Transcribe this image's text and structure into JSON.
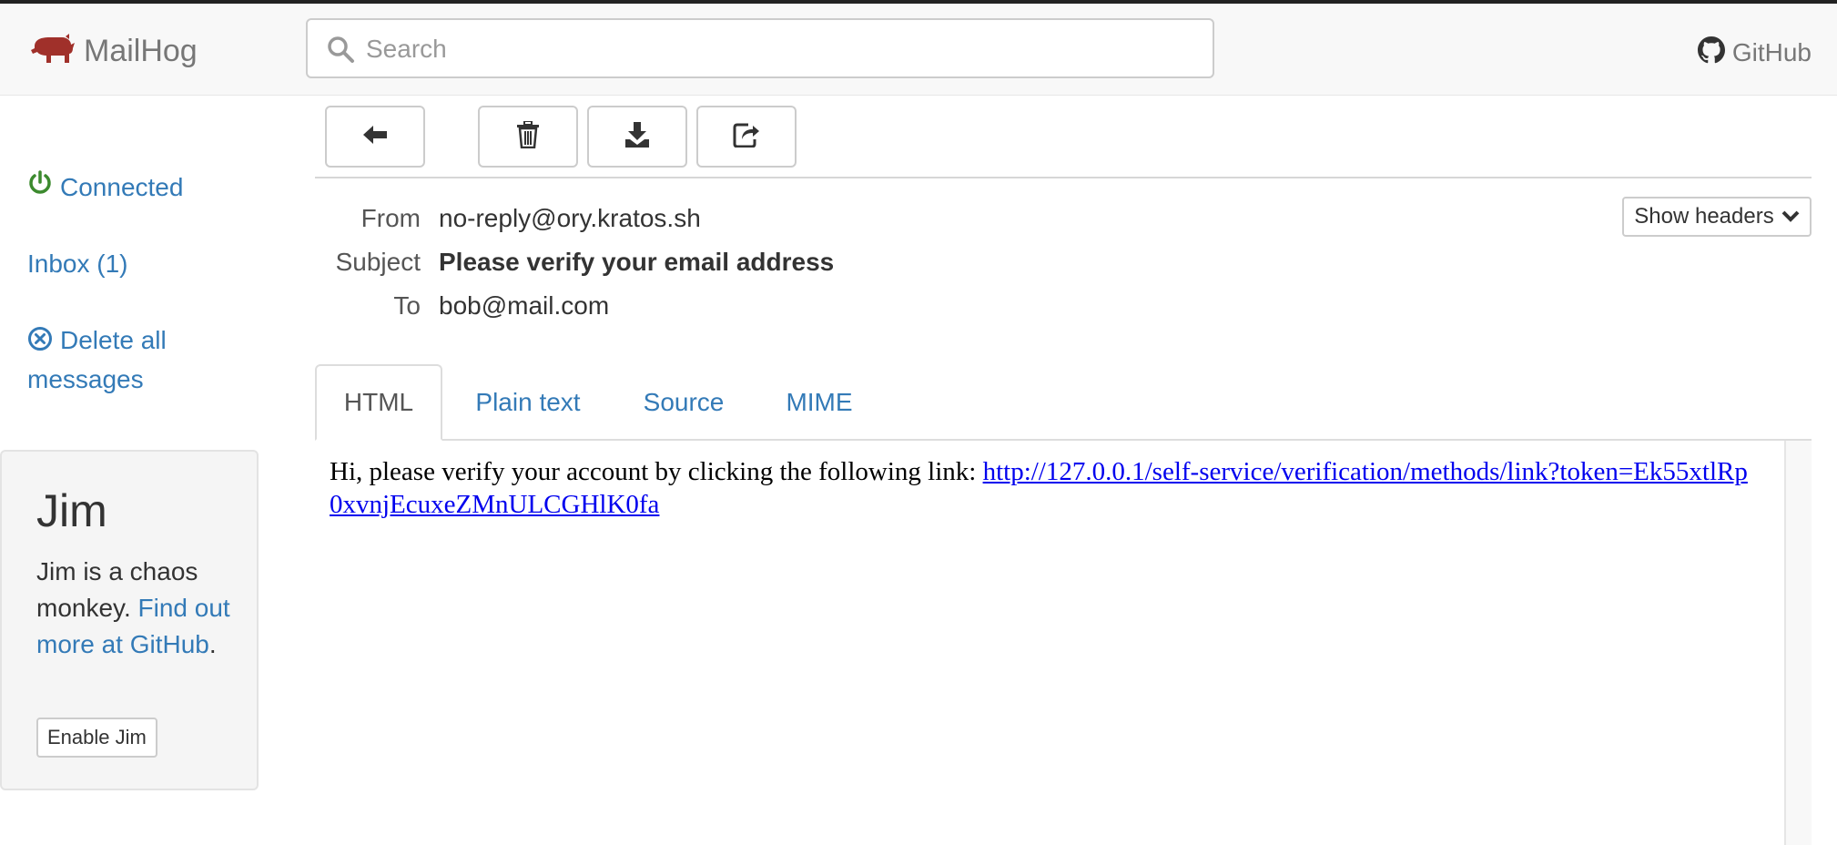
{
  "app": {
    "name": "MailHog",
    "brand_color": "#a0302a"
  },
  "search": {
    "placeholder": "Search"
  },
  "github_link": {
    "label": "GitHub"
  },
  "sidebar": {
    "status": "Connected",
    "status_color": "#3c8a2e",
    "inbox": "Inbox (1)",
    "delete_all": "Delete all messages"
  },
  "jim": {
    "title": "Jim",
    "description": "Jim is a chaos monkey.",
    "more_link": "Find out more at GitHub",
    "more_suffix": ".",
    "enable_button": "Enable Jim"
  },
  "toolbar": {
    "back_icon": "arrow-left-icon",
    "delete_icon": "trash-icon",
    "download_icon": "download-icon",
    "release_icon": "share-icon"
  },
  "message": {
    "from_label": "From",
    "from": "no-reply@ory.kratos.sh",
    "subject_label": "Subject",
    "subject": "Please verify your email address",
    "to_label": "To",
    "to": "bob@mail.com",
    "show_headers": "Show headers"
  },
  "tabs": [
    {
      "label": "HTML",
      "active": true
    },
    {
      "label": "Plain text",
      "active": false
    },
    {
      "label": "Source",
      "active": false
    },
    {
      "label": "MIME",
      "active": false
    }
  ],
  "body": {
    "text": "Hi, please verify your account by clicking the following link:",
    "link": "http://127.0.0.1/self-service/verification/methods/link?token=Ek55xtlRp0xvnjEcuxeZMnULCGHlK0fa"
  }
}
